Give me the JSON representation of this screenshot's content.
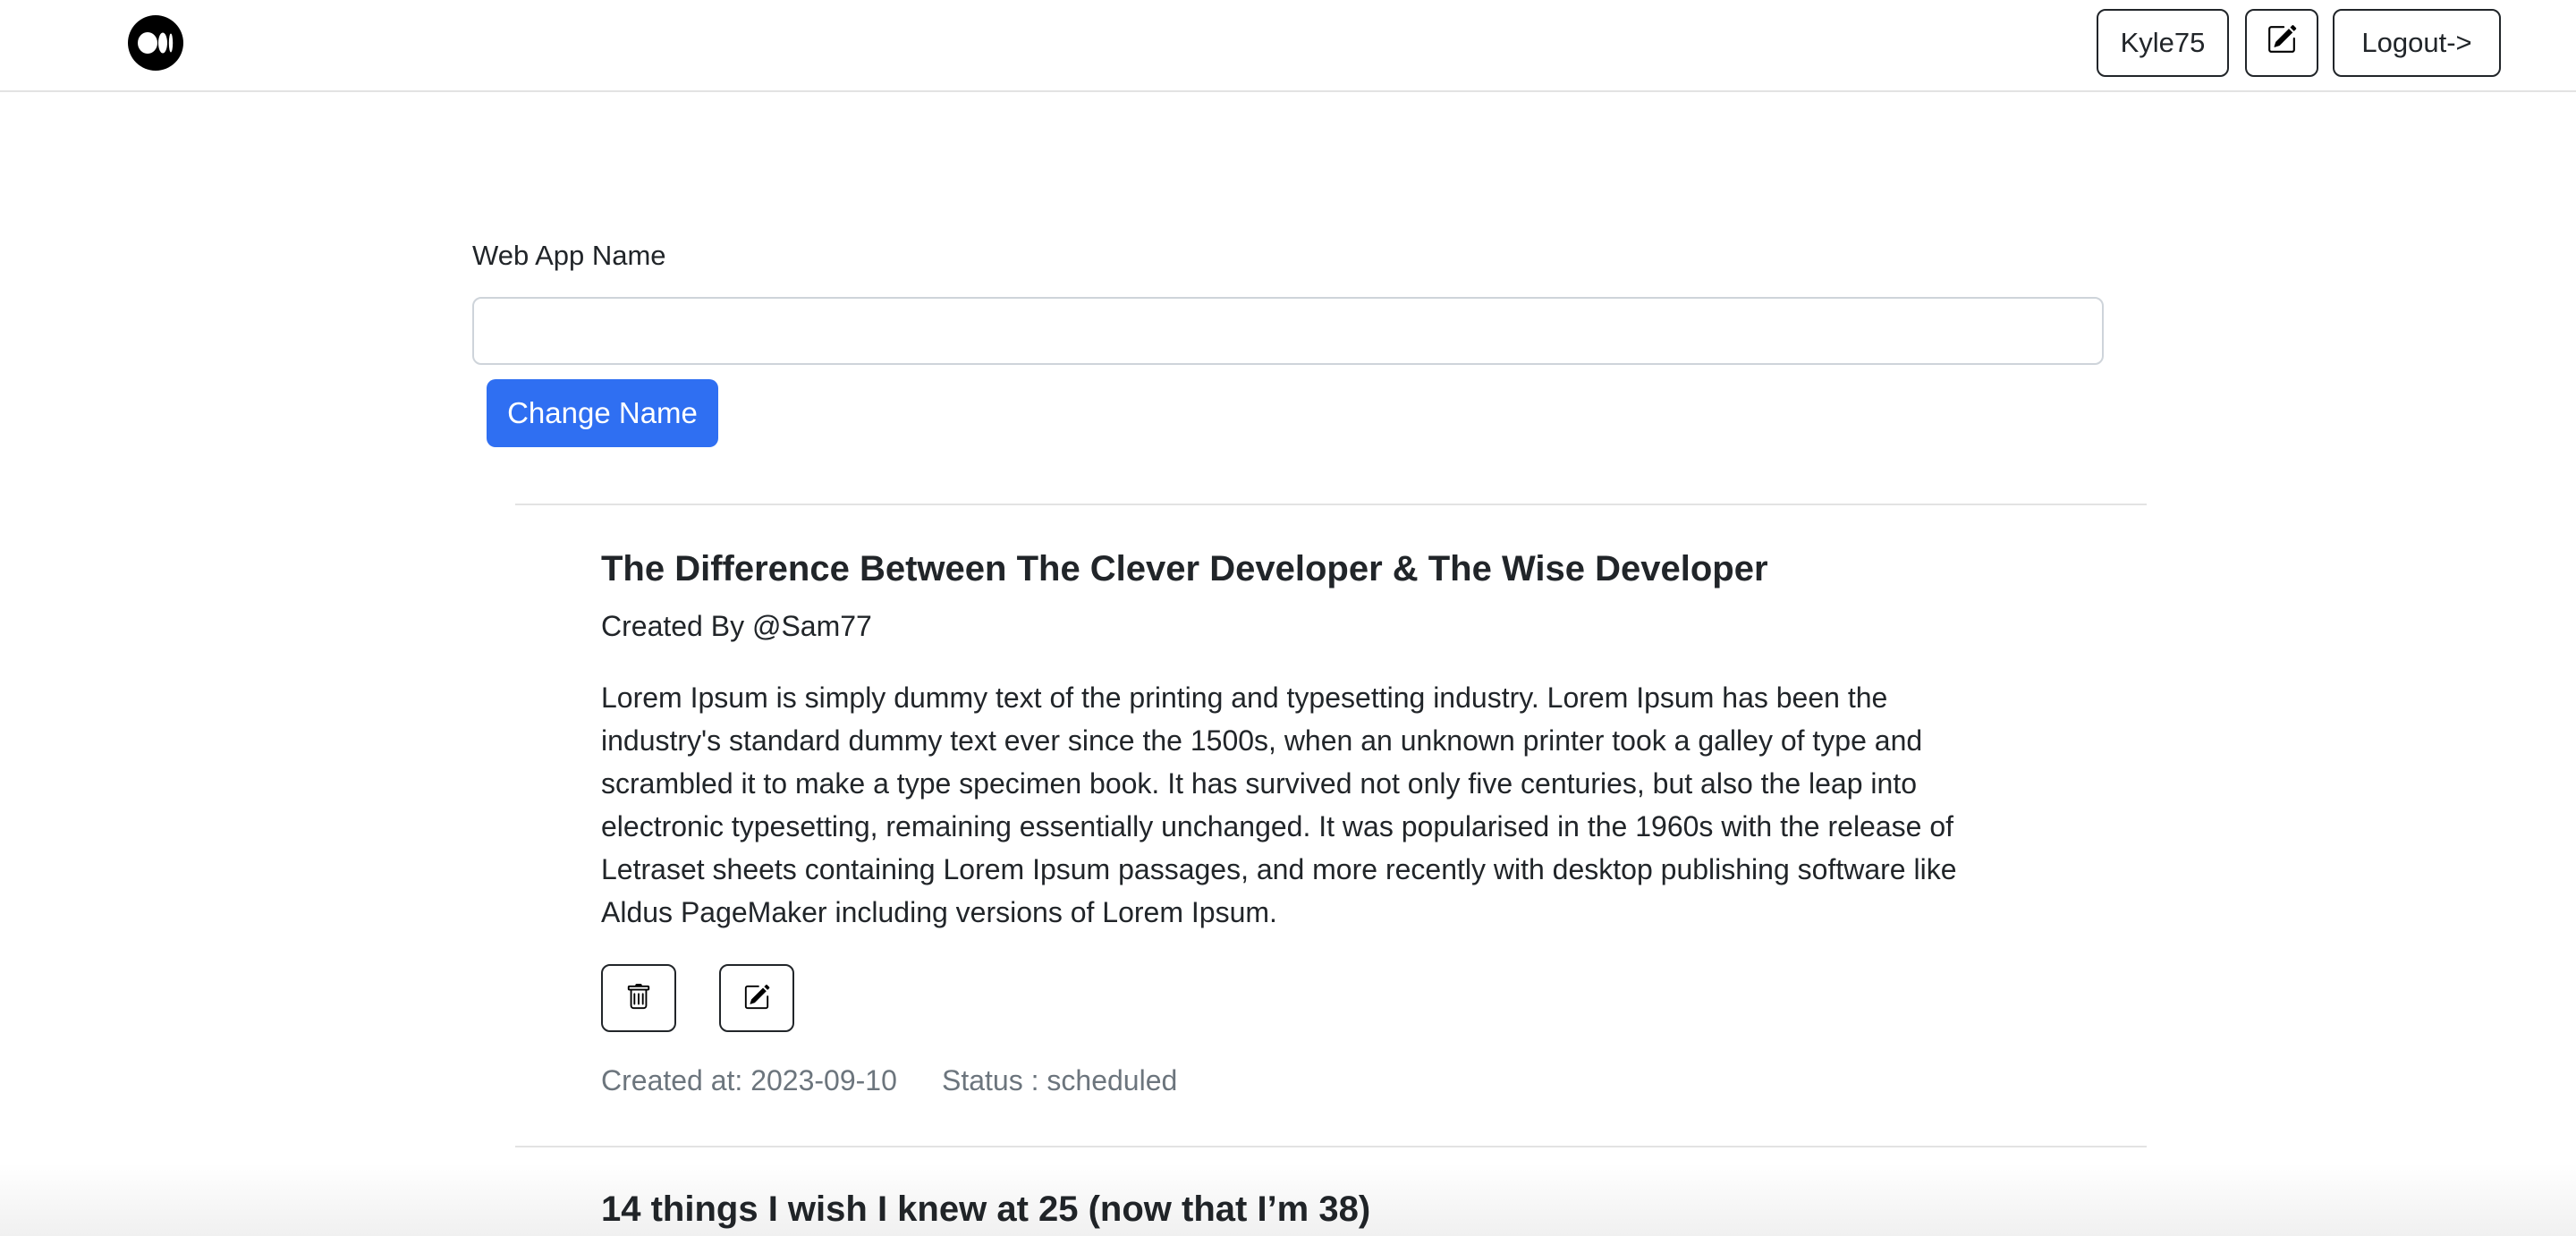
{
  "header": {
    "logo_icon": "medium-logo-icon",
    "user_label": "Kyle75",
    "write_icon": "edit-icon",
    "logout_label": "Logout->"
  },
  "form": {
    "label": "Web App Name",
    "input_value": "",
    "input_placeholder": "",
    "submit_label": "Change Name"
  },
  "posts": [
    {
      "title": "The Difference Between The Clever Developer & The Wise Developer",
      "author": "Created By @Sam77",
      "body": "Lorem Ipsum is simply dummy text of the printing and typesetting industry. Lorem Ipsum has been the industry's standard dummy text ever since the 1500s, when an unknown printer took a galley of type and scrambled it to make a type specimen book. It has survived not only five centuries, but also the leap into electronic typesetting, remaining essentially unchanged. It was popularised in the 1960s with the release of Letraset sheets containing Lorem Ipsum passages, and more recently with desktop publishing software like Aldus PageMaker including versions of Lorem Ipsum.",
      "delete_icon": "trash-icon",
      "edit_icon": "edit-icon",
      "created_at": "Created at: 2023-09-10",
      "status": "Status : scheduled"
    },
    {
      "title": "14 things I wish I knew at 25 (now that I’m 38)"
    }
  ],
  "colors": {
    "primary": "#2f6ff2",
    "muted": "#6c757d",
    "text": "#212529",
    "divider": "#e3e3e3"
  }
}
